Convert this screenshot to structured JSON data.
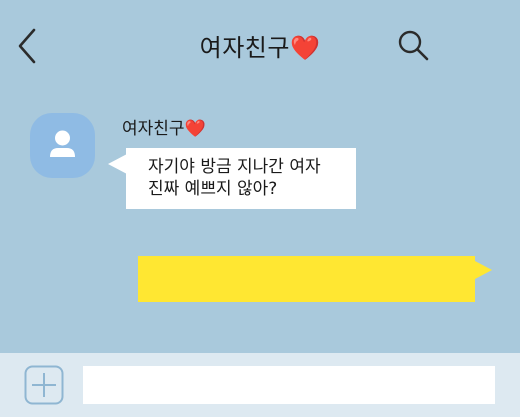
{
  "header": {
    "title": "여자친구❤️",
    "back_icon": "chevron-left-icon",
    "search_icon": "search-icon"
  },
  "messages": [
    {
      "direction": "incoming",
      "sender": "여자친구❤️",
      "lines": [
        "자기야 방금 지나간 여자",
        "진짜 예쁘지 않아?"
      ]
    },
    {
      "direction": "outgoing",
      "text": ""
    }
  ],
  "input_bar": {
    "add_icon": "plus-box-icon",
    "value": ""
  },
  "colors": {
    "background": "#a9c9dc",
    "incoming_bubble": "#ffffff",
    "outgoing_bubble": "#ffe732",
    "avatar": "#8fbbe4",
    "input_bar": "#dde9f1",
    "icon_stroke": "#4a4a4a"
  }
}
